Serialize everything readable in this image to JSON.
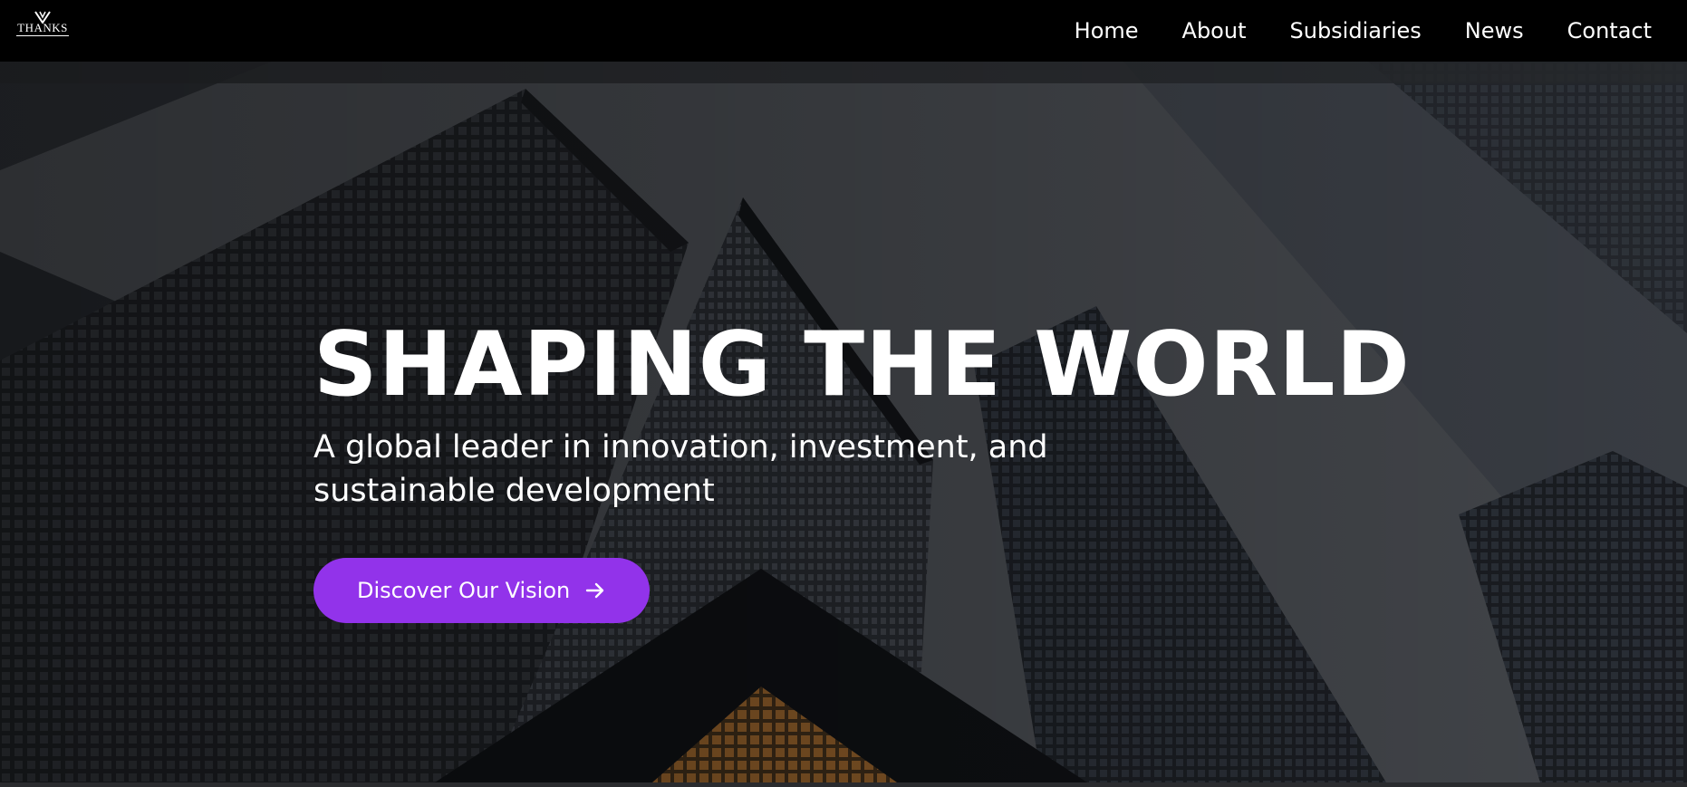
{
  "brand": {
    "logo_text": "THANKS"
  },
  "nav": {
    "items": [
      {
        "label": "Home"
      },
      {
        "label": "About"
      },
      {
        "label": "Subsidiaries"
      },
      {
        "label": "News"
      },
      {
        "label": "Contact"
      }
    ]
  },
  "hero": {
    "title": "SHAPING THE WORLD",
    "subtitle": "A global leader in innovation, investment, and sustainable development",
    "cta_label": "Discover Our Vision",
    "cta_icon": "arrow-right-icon",
    "background_image": "low-angle view of skyscrapers against a grey sky"
  },
  "colors": {
    "nav_background": "#000000",
    "text": "#ffffff",
    "accent": "#9233ea"
  }
}
